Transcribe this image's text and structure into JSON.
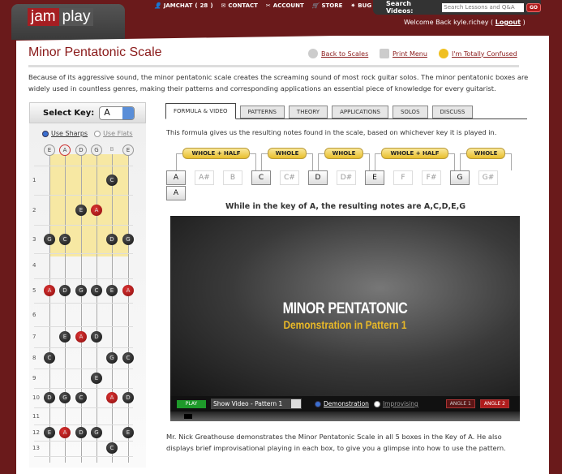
{
  "header": {
    "logo": [
      "jam",
      "play"
    ],
    "nav": [
      {
        "icon": "user-icon",
        "label": "JAMCHAT",
        "count": "28"
      },
      {
        "icon": "mail-icon",
        "label": "CONTACT"
      },
      {
        "icon": "tools-icon",
        "label": "ACCOUNT"
      },
      {
        "icon": "cart-icon",
        "label": "STORE"
      },
      {
        "icon": "bug-icon",
        "label": "BUG"
      }
    ],
    "search_label": "Search Videos:",
    "search_placeholder": "Search Lessons and Q&A",
    "go": "GO",
    "welcome": "Welcome Back kyle.richey (",
    "logout": "Logout",
    "welcome_end": ")"
  },
  "page": {
    "title": "Minor Pentatonic Scale",
    "links": [
      "Back to Scales",
      "Print Menu",
      "I'm Totally Confused"
    ],
    "intro": "Because of its aggressive sound, the minor pentatonic scale creates the screaming sound of most rock guitar solos. The minor pentatonic boxes are widely used in countless genres, making their patterns and corresponding applications an essential piece of knowledge for every guitarist."
  },
  "sidebar": {
    "select_key_label": "Select Key:",
    "key": "A",
    "use_sharps": "Use Sharps",
    "use_flats": "Use Flats",
    "open_strings": [
      "E",
      "A",
      "D",
      "G",
      "B",
      "E"
    ],
    "frets": [
      "1",
      "2",
      "3",
      "4",
      "5",
      "6",
      "7",
      "8",
      "9",
      "10",
      "11",
      "12",
      "13"
    ],
    "notes": [
      {
        "fret": 1,
        "string": 4,
        "note": "C"
      },
      {
        "fret": 2,
        "string": 2,
        "note": "E"
      },
      {
        "fret": 2,
        "string": 3,
        "note": "A",
        "root": true
      },
      {
        "fret": 3,
        "string": 0,
        "note": "G"
      },
      {
        "fret": 3,
        "string": 1,
        "note": "C"
      },
      {
        "fret": 3,
        "string": 4,
        "note": "D"
      },
      {
        "fret": 3,
        "string": 5,
        "note": "G"
      },
      {
        "fret": 5,
        "string": 0,
        "note": "A",
        "root": true
      },
      {
        "fret": 5,
        "string": 1,
        "note": "D"
      },
      {
        "fret": 5,
        "string": 2,
        "note": "G"
      },
      {
        "fret": 5,
        "string": 3,
        "note": "C"
      },
      {
        "fret": 5,
        "string": 4,
        "note": "E"
      },
      {
        "fret": 5,
        "string": 5,
        "note": "A",
        "root": true
      },
      {
        "fret": 7,
        "string": 1,
        "note": "E"
      },
      {
        "fret": 7,
        "string": 2,
        "note": "A",
        "root": true
      },
      {
        "fret": 7,
        "string": 3,
        "note": "D"
      },
      {
        "fret": 8,
        "string": 0,
        "note": "C"
      },
      {
        "fret": 8,
        "string": 4,
        "note": "G"
      },
      {
        "fret": 8,
        "string": 5,
        "note": "C"
      },
      {
        "fret": 9,
        "string": 3,
        "note": "E"
      },
      {
        "fret": 10,
        "string": 0,
        "note": "D"
      },
      {
        "fret": 10,
        "string": 1,
        "note": "G"
      },
      {
        "fret": 10,
        "string": 2,
        "note": "C"
      },
      {
        "fret": 10,
        "string": 4,
        "note": "A",
        "root": true
      },
      {
        "fret": 10,
        "string": 5,
        "note": "D"
      },
      {
        "fret": 12,
        "string": 0,
        "note": "E"
      },
      {
        "fret": 12,
        "string": 1,
        "note": "A",
        "root": true
      },
      {
        "fret": 12,
        "string": 2,
        "note": "D"
      },
      {
        "fret": 12,
        "string": 3,
        "note": "G"
      },
      {
        "fret": 12,
        "string": 5,
        "note": "E"
      },
      {
        "fret": 13,
        "string": 4,
        "note": "C"
      }
    ]
  },
  "tabs": [
    "FORMULA & VIDEO",
    "PATTERNS",
    "THEORY",
    "APPLICATIONS",
    "SOLOS",
    "DISCUSS"
  ],
  "formula": {
    "description": "This formula gives us the resulting notes found in the scale, based on whichever key it is played in.",
    "intervals": [
      "WHOLE + HALF",
      "WHOLE",
      "WHOLE",
      "WHOLE + HALF",
      "WHOLE"
    ],
    "chromatic": [
      "A",
      "A#",
      "B",
      "C",
      "C#",
      "D",
      "D#",
      "E",
      "F",
      "F#",
      "G",
      "G#"
    ],
    "scale_notes": [
      "A",
      "C",
      "D",
      "E",
      "G"
    ],
    "octave": "A",
    "result": "While in the key of A, the resulting notes are A,C,D,E,G"
  },
  "video": {
    "title": "MINOR PENTATONIC",
    "subtitle": "Demonstration in Pattern 1",
    "play": "PLAY",
    "select": "Show Video - Pattern 1",
    "mode_on": "Demonstration",
    "mode_off": "Improvising",
    "angle1": "ANGLE 1",
    "angle2": "ANGLE 2",
    "description": "Mr. Nick Greathouse demonstrates the Minor Pentatonic Scale in all 5 boxes in the Key of A. He also displays brief improvisational playing in each box, to give you a glimpse into how to use the pattern."
  },
  "colors": {
    "background": "#6a1a1b",
    "title": "#8a1a1a",
    "root_note": "#c22222",
    "interval_pill": "#f0d050"
  }
}
